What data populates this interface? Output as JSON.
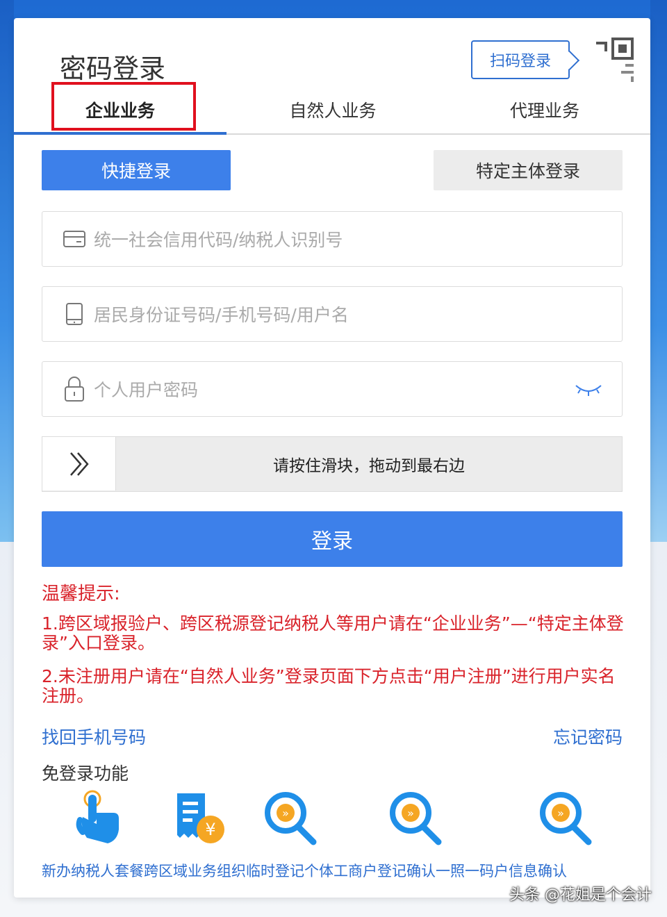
{
  "header": {
    "title": "密码登录",
    "scan_login_label": "扫码登录"
  },
  "tabs": [
    {
      "label": "企业业务",
      "active": true
    },
    {
      "label": "自然人业务",
      "active": false
    },
    {
      "label": "代理业务",
      "active": false
    }
  ],
  "login_modes": {
    "quick_label": "快捷登录",
    "special_label": "特定主体登录"
  },
  "form": {
    "credit_code_placeholder": "统一社会信用代码/纳税人识别号",
    "id_placeholder": "居民身份证号码/手机号码/用户名",
    "password_placeholder": "个人用户密码",
    "slider_text": "请按住滑块，拖动到最右边",
    "login_label": "登录"
  },
  "tips": {
    "title": "温馨提示:",
    "item1": "1.跨区域报验户、跨区税源登记纳税人等用户请在“企业业务”—“特定主体登录”入口登录。",
    "item2": "2.未注册用户请在“自然人业务”登录页面下方点击“用户注册”进行用户实名注册。"
  },
  "links": {
    "recover_phone": "找回手机号码",
    "forgot_password": "忘记密码"
  },
  "free_login": {
    "title": "免登录功能",
    "items": [
      {
        "label": "新办纳税人套餐",
        "icon": "hand-tap-icon"
      },
      {
        "label": "跨区域业务",
        "icon": "receipt-yen-icon"
      },
      {
        "label": "组织临时登记",
        "icon": "search-arrow-icon"
      },
      {
        "label": "个体工商户登记确认",
        "icon": "search-arrow-icon"
      },
      {
        "label": "一照一码户信息确认",
        "icon": "search-arrow-icon"
      }
    ]
  },
  "watermark": "头条 @花姐是个会计",
  "colors": {
    "primary": "#3d80ea",
    "link": "#2f6fd0",
    "warning": "#d9222a",
    "highlight_box": "#e0101e"
  }
}
